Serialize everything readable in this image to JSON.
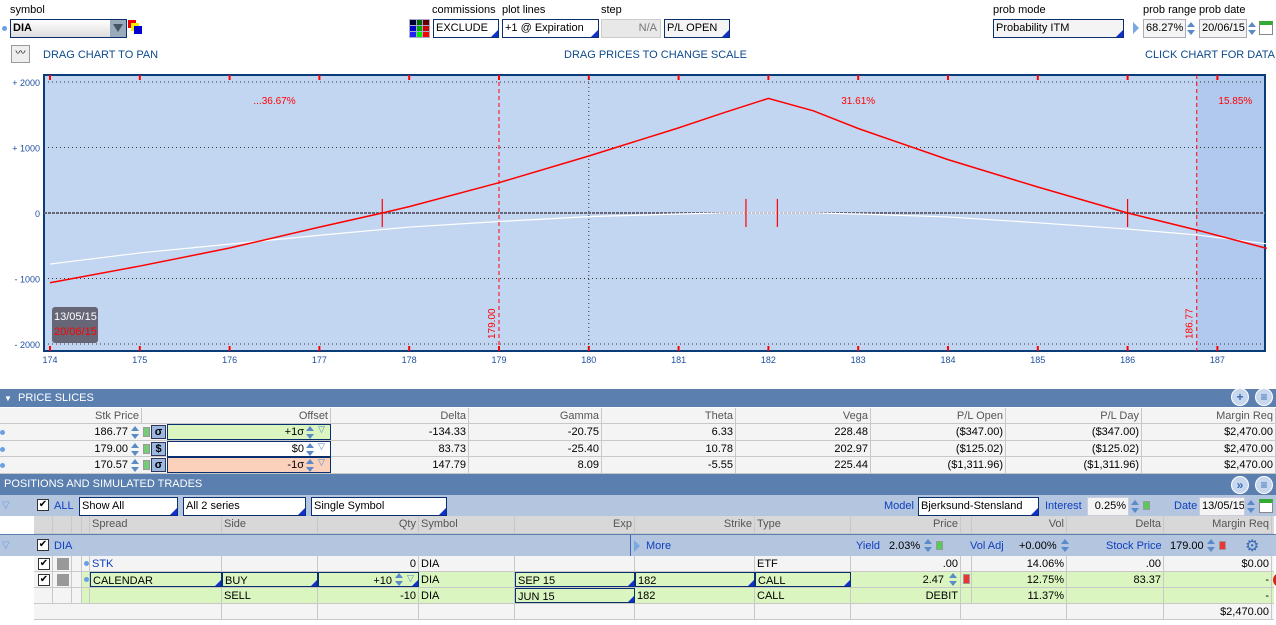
{
  "toolbar": {
    "symbol_label": "symbol",
    "symbol_value": "DIA",
    "commissions_label": "commissions",
    "commissions_value": "EXCLUDE",
    "plot_lines_label": "plot lines",
    "plot_lines_value": "+1 @ Expiration",
    "step_label": "step",
    "step_value": "N/A",
    "pl_mode_value": "P/L OPEN",
    "prob_mode_label": "prob mode",
    "prob_mode_value": "Probability ITM",
    "prob_range_label": "prob range",
    "prob_range_value": "68.27%",
    "prob_date_label": "prob date",
    "prob_date_value": "20/06/15",
    "hint_pan": "DRAG CHART TO PAN",
    "hint_scale": "DRAG PRICES TO CHANGE SCALE",
    "hint_click": "CLICK CHART FOR DATA"
  },
  "chart_data": {
    "type": "line",
    "xlim": [
      173.95,
      187.55
    ],
    "ylim": [
      -2000,
      2000
    ],
    "x_ticks": [
      174,
      175,
      176,
      177,
      178,
      179,
      180,
      181,
      182,
      183,
      184,
      185,
      186,
      187
    ],
    "y_ticks": [
      {
        "v": 2000,
        "label": "+ 2000"
      },
      {
        "v": 1000,
        "label": "+ 1000"
      },
      {
        "v": 0,
        "label": "0"
      },
      {
        "v": -1000,
        "label": "- 1000"
      },
      {
        "v": -2000,
        "label": "- 2000"
      }
    ],
    "series": [
      {
        "name": "20/06/15",
        "color": "#ff0000",
        "x": [
          174,
          175,
          176,
          177,
          177.7,
          178,
          179,
          180,
          181,
          181.5,
          182,
          182.5,
          183,
          184,
          185,
          186,
          186.77,
          187.55
        ],
        "y": [
          -1065,
          -810,
          -535,
          -215,
          0,
          97,
          463,
          870,
          1300,
          1530,
          1750,
          1560,
          1290,
          815,
          397,
          0,
          -260,
          -540
        ]
      },
      {
        "name": "13/05/15",
        "color": "#ffffff",
        "x": [
          174,
          175,
          176,
          177,
          178,
          179,
          180,
          181,
          181.5,
          182.5,
          183,
          184,
          185,
          186,
          186.77,
          187.55
        ],
        "y": [
          -780,
          -610,
          -475,
          -340,
          -215,
          -130,
          -55,
          -15,
          0,
          0,
          -15,
          -60,
          -150,
          -245,
          -335,
          -470
        ]
      }
    ],
    "price_lines": [
      {
        "x": 179,
        "label": "179.00"
      },
      {
        "x": 186.77,
        "label": "186.77"
      }
    ],
    "current_line": 180,
    "markers": [
      177.7,
      181.75,
      182.1,
      186.0
    ],
    "prob_labels": [
      {
        "x": 176.5,
        "text": "...36.67%"
      },
      {
        "x": 183,
        "text": "31.61%"
      },
      {
        "x": 187.2,
        "text": "15.85%"
      }
    ],
    "legend": {
      "today": "13/05/15",
      "expiration": "20/06/15"
    }
  },
  "price_slices": {
    "title": "PRICE SLICES",
    "columns": [
      "Stk Price",
      "Offset",
      "Delta",
      "Gamma",
      "Theta",
      "Vega",
      "P/L Open",
      "P/L Day",
      "Margin Req"
    ],
    "rows": [
      {
        "stk": "186.77",
        "type": "σ",
        "offset": "+1σ",
        "delta": "-134.33",
        "gamma": "-20.75",
        "theta": "6.33",
        "vega": "228.48",
        "pl_open": "($347.00)",
        "pl_day": "($347.00)",
        "margin": "$2,470.00"
      },
      {
        "stk": "179.00",
        "type": "$",
        "offset": "$0",
        "delta": "83.73",
        "gamma": "-25.40",
        "theta": "10.78",
        "vega": "202.97",
        "pl_open": "($125.02)",
        "pl_day": "($125.02)",
        "margin": "$2,470.00"
      },
      {
        "stk": "170.57",
        "type": "σ",
        "offset": "-1σ",
        "delta": "147.79",
        "gamma": "8.09",
        "theta": "-5.55",
        "vega": "225.44",
        "pl_open": "($1,311.96)",
        "pl_day": "($1,311.96)",
        "margin": "$2,470.00"
      }
    ]
  },
  "positions": {
    "title": "POSITIONS AND SIMULATED TRADES",
    "all_label": "ALL",
    "filter1": "Show All",
    "filter2": "All 2 series",
    "filter3": "Single Symbol",
    "model_label": "Model",
    "model_value": "Bjerksund-Stensland",
    "interest_label": "Interest",
    "interest_value": "0.25%",
    "date_label": "Date",
    "date_value": "13/05/15",
    "columns": [
      "Spread",
      "Side",
      "Qty",
      "Symbol",
      "Exp",
      "Strike",
      "Type",
      "Price",
      "Vol",
      "Delta",
      "Margin Req"
    ],
    "group": {
      "symbol": "DIA",
      "more": "More",
      "yield_label": "Yield",
      "yield_value": "2.03%",
      "voladj_label": "Vol Adj",
      "voladj_value": "+0.00%",
      "stock_price_label": "Stock Price",
      "stock_price_value": "179.00"
    },
    "rows": [
      {
        "spread": "STK",
        "side": "",
        "qty": "0",
        "symbol": "DIA",
        "exp": "",
        "strike": "",
        "type": "ETF",
        "price": ".00",
        "vol": "14.06%",
        "delta": ".00",
        "margin": "$0.00"
      },
      {
        "spread": "CALENDAR",
        "side": "BUY",
        "qty": "+10",
        "symbol": "DIA",
        "exp": "SEP 15",
        "strike": "182",
        "type": "CALL",
        "price": "2.47",
        "vol": "12.75%",
        "delta": "83.37",
        "margin": "-"
      },
      {
        "spread": "",
        "side": "SELL",
        "qty": "-10",
        "symbol": "DIA",
        "exp": "JUN 15",
        "strike": "182",
        "type": "CALL",
        "price": "DEBIT",
        "vol": "11.37%",
        "delta": "",
        "margin": "-"
      }
    ],
    "total_margin": "$2,470.00"
  }
}
